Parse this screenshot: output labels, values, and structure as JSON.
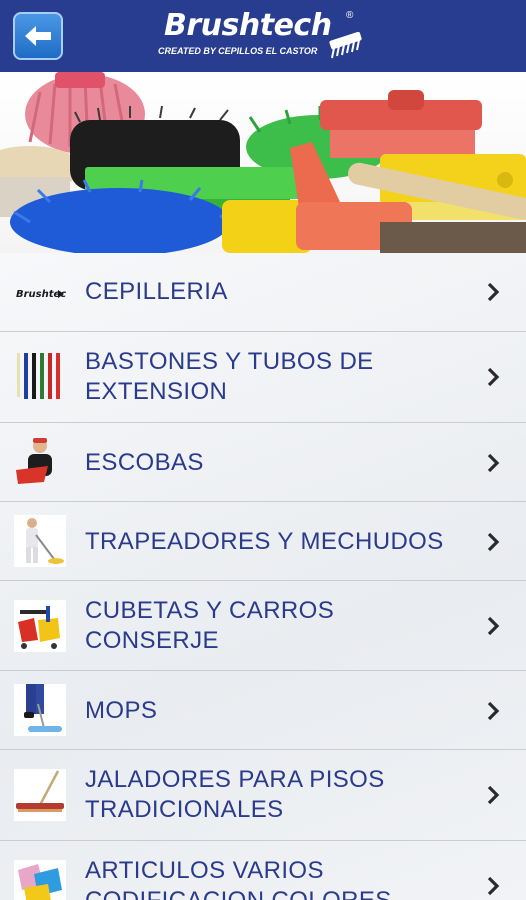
{
  "header": {
    "back_icon": "back-arrow-icon",
    "logo_text": "Brushtech",
    "logo_mark": "®",
    "logo_tagline": "CREATED BY CEPILLOS EL CASTOR"
  },
  "colors": {
    "header_bg": "#283d8f",
    "label_text": "#2b3b8b",
    "back_button": "#2f80d4"
  },
  "menu": {
    "items": [
      {
        "label": "CEPILLERIA",
        "icon": "brushtech-logo-icon"
      },
      {
        "label": "BASTONES Y TUBOS DE EXTENSION",
        "icon": "extension-poles-icon"
      },
      {
        "label": "ESCOBAS",
        "icon": "broom-person-icon"
      },
      {
        "label": "TRAPEADORES Y MECHUDOS",
        "icon": "mopping-person-icon"
      },
      {
        "label": "CUBETAS Y CARROS CONSERJE",
        "icon": "bucket-cart-icon"
      },
      {
        "label": "MOPS",
        "icon": "dust-mop-icon"
      },
      {
        "label": "JALADORES PARA PISOS TRADICIONALES",
        "icon": "floor-squeegee-icon"
      },
      {
        "label": "ARTICULOS VARIOS CODIFICACION COLORES",
        "icon": "color-cloths-icon"
      }
    ]
  }
}
